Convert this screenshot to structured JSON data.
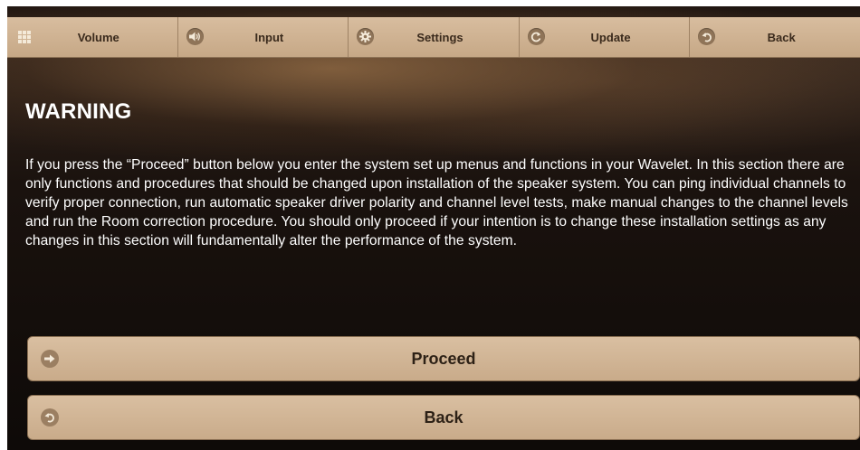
{
  "topnav": {
    "items": [
      {
        "label": "Volume",
        "icon": "grid-icon"
      },
      {
        "label": "Input",
        "icon": "speaker-icon"
      },
      {
        "label": "Settings",
        "icon": "gear-icon"
      },
      {
        "label": "Update",
        "icon": "refresh-icon"
      },
      {
        "label": "Back",
        "icon": "back-arrow-icon"
      }
    ]
  },
  "warning": {
    "title": "WARNING",
    "body": "If you press the “Proceed” button below you enter the system set up menus and functions in your Wavelet. In this section there are only functions and procedures that should be changed upon installation of the speaker system. You can ping individual channels to verify proper connection, run automatic speaker driver polarity and channel level tests, make manual changes to the channel levels and run the Room correction procedure. You should only proceed if your intention is to change these installation settings as any changes in this section will fundamentally alter the performance of the system."
  },
  "actions": {
    "proceed_label": "Proceed",
    "proceed_icon": "arrow-right-icon",
    "back_label": "Back",
    "back_icon": "back-arrow-icon"
  },
  "colors": {
    "button_bg": "#d4b797",
    "button_text": "#2d2116",
    "icon_circle": "#8f7458"
  }
}
